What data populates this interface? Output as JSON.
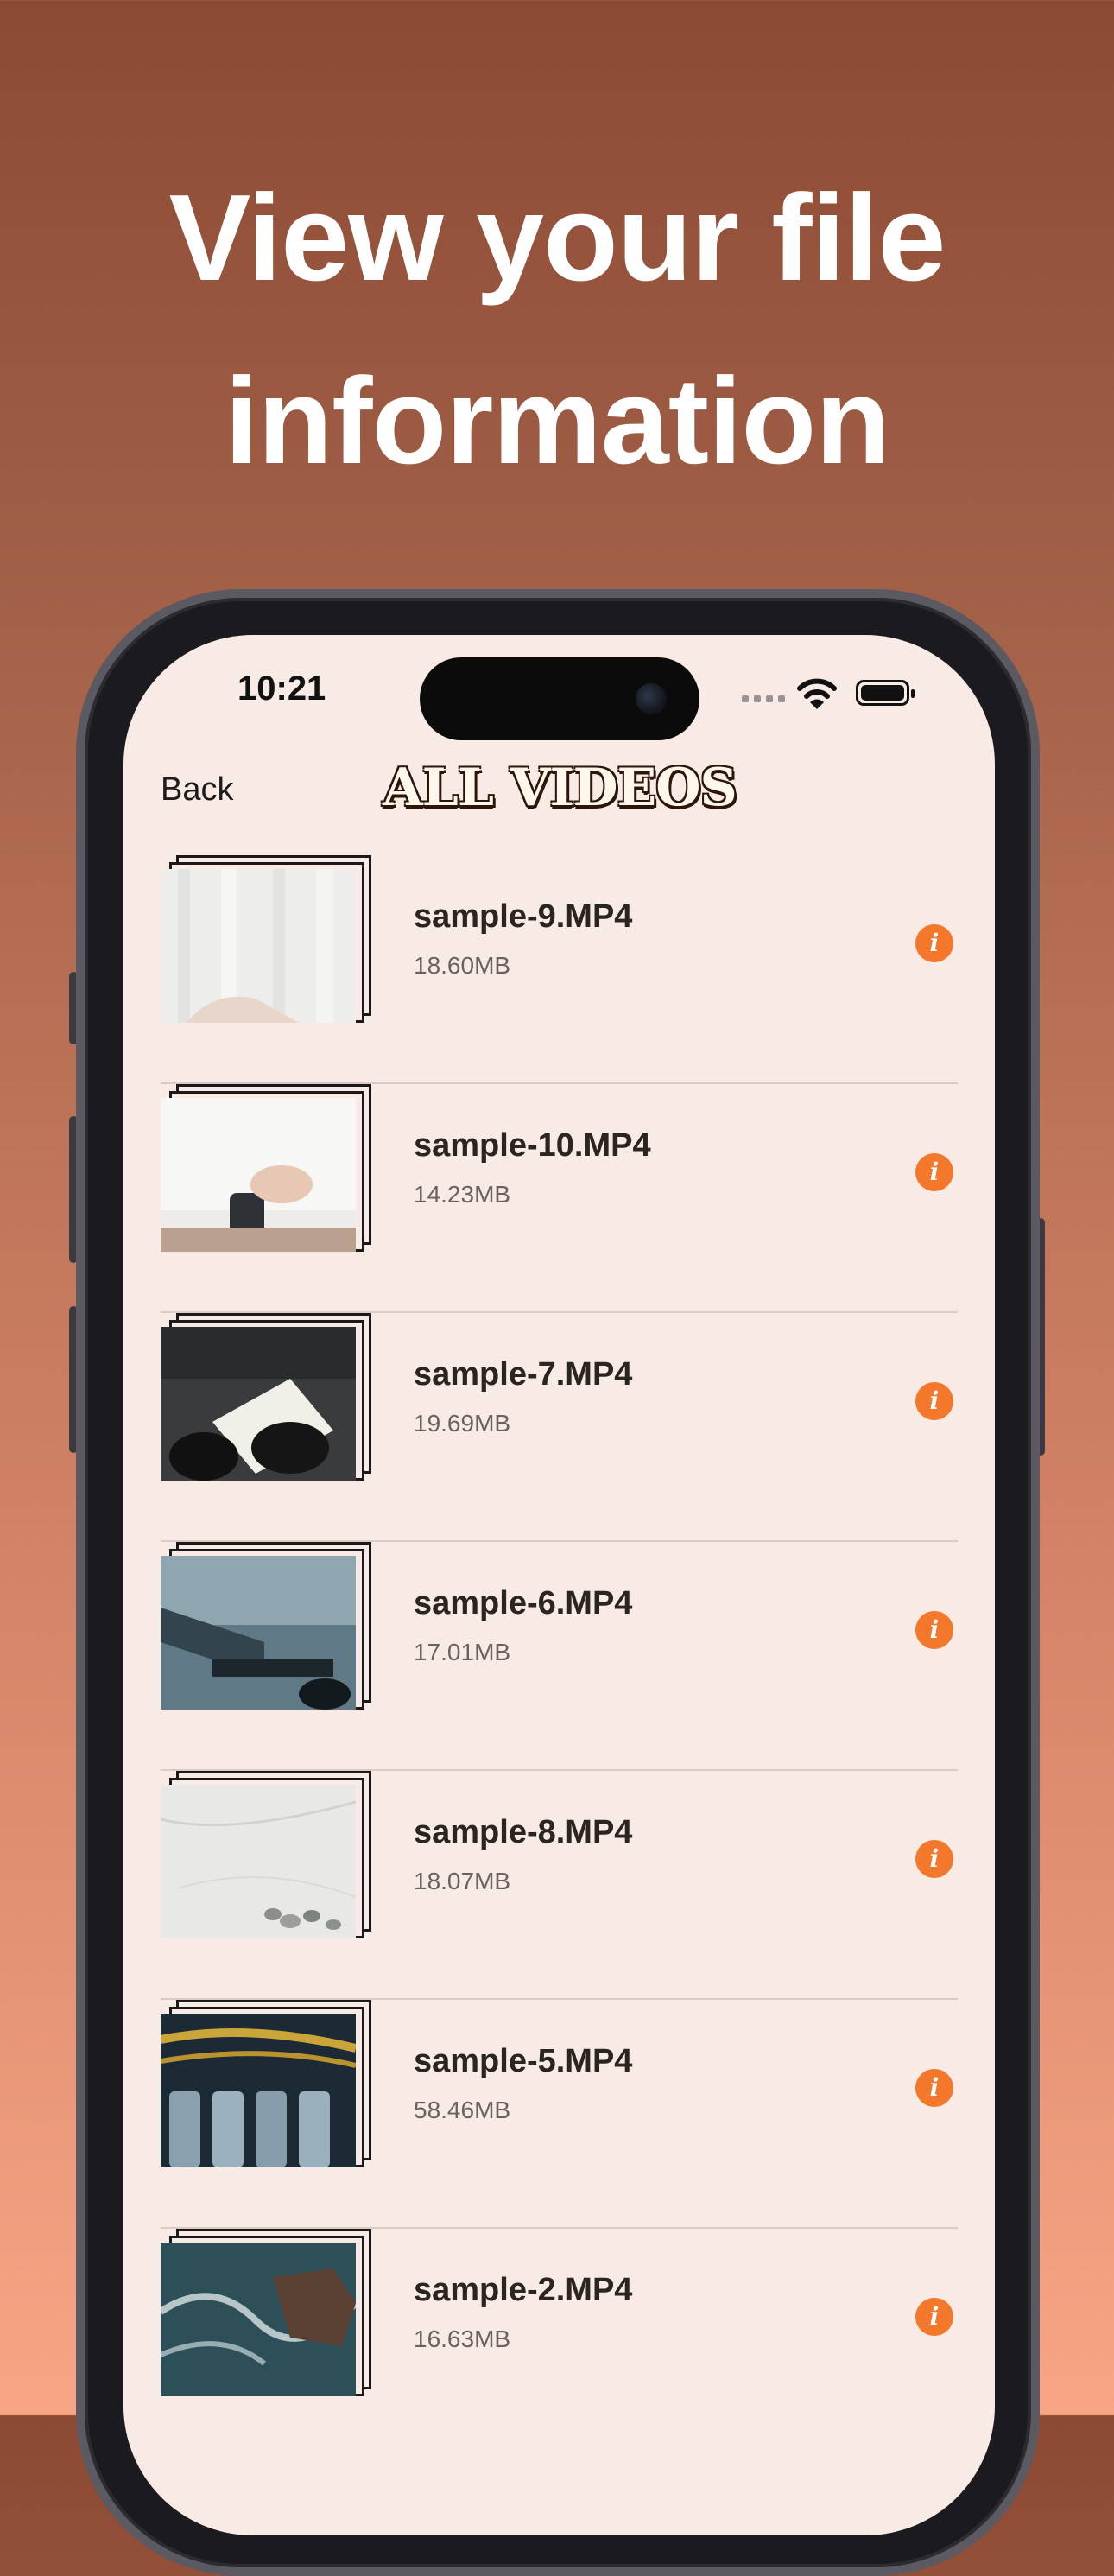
{
  "headline": {
    "line1": "View your file",
    "line2": "information"
  },
  "status_bar": {
    "time": "10:21"
  },
  "nav": {
    "back_label": "Back",
    "title": "ALL VIDEOS"
  },
  "colors": {
    "accent": "#f4782b",
    "screen_bg": "#f8ebe6"
  },
  "videos": [
    {
      "name": "sample-9.MP4",
      "size": "18.60MB",
      "thumb": "white-curtain-hand"
    },
    {
      "name": "sample-10.MP4",
      "size": "14.23MB",
      "thumb": "white-shirt-bottle"
    },
    {
      "name": "sample-7.MP4",
      "size": "19.69MB",
      "thumb": "gloves-paper"
    },
    {
      "name": "sample-6.MP4",
      "size": "17.01MB",
      "thumb": "wet-metal"
    },
    {
      "name": "sample-8.MP4",
      "size": "18.07MB",
      "thumb": "marble-pebbles"
    },
    {
      "name": "sample-5.MP4",
      "size": "58.46MB",
      "thumb": "factory-bottles"
    },
    {
      "name": "sample-2.MP4",
      "size": "16.63MB",
      "thumb": "ocean-rocks"
    }
  ]
}
